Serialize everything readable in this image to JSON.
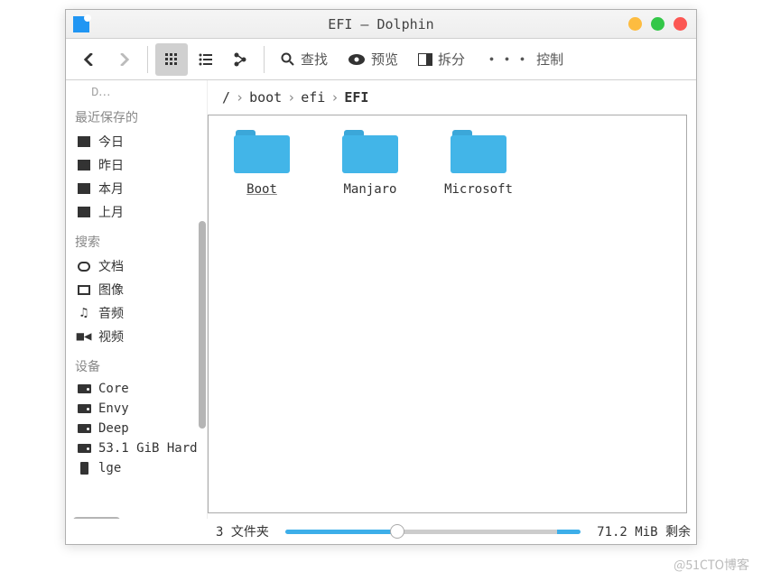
{
  "window": {
    "title": "EFI — Dolphin"
  },
  "toolbar": {
    "search": "查找",
    "preview": "预览",
    "split": "拆分",
    "control": "控制"
  },
  "breadcrumb": {
    "root": "/",
    "p1": "boot",
    "p2": "efi",
    "current": "EFI"
  },
  "sidebar": {
    "truncated": "D…",
    "recent_header": "最近保存的",
    "recent": [
      "今日",
      "昨日",
      "本月",
      "上月"
    ],
    "search_header": "搜索",
    "search": [
      "文档",
      "图像",
      "音频",
      "视频"
    ],
    "devices_header": "设备",
    "devices": [
      "Core",
      "Envy",
      "Deep",
      "53.1 GiB Hard",
      "lge"
    ]
  },
  "files": [
    {
      "name": "Boot",
      "selected": true
    },
    {
      "name": "Manjaro",
      "selected": false
    },
    {
      "name": "Microsoft",
      "selected": false
    }
  ],
  "status": {
    "count": "3 文件夹",
    "space": "71.2 MiB 剩余"
  },
  "watermark": "@51CTO博客"
}
